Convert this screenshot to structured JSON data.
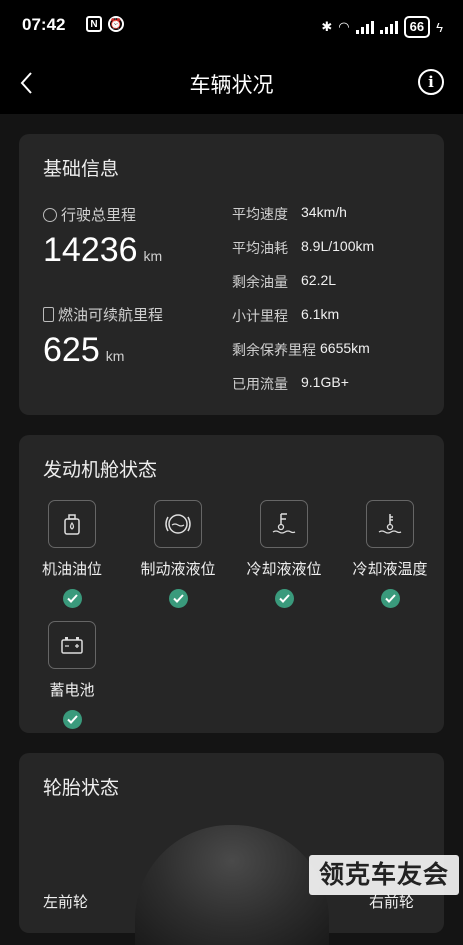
{
  "status_bar": {
    "time": "07:42",
    "battery": "66"
  },
  "header": {
    "title": "车辆状况"
  },
  "basic_info": {
    "title": "基础信息",
    "total_mileage_label": "行驶总里程",
    "total_mileage_value": "14236",
    "total_mileage_unit": "km",
    "range_label": "燃油可续航里程",
    "range_value": "625",
    "range_unit": "km",
    "stats": [
      {
        "label": "平均速度",
        "value": "34km/h"
      },
      {
        "label": "平均油耗",
        "value": "8.9L/100km"
      },
      {
        "label": "剩余油量",
        "value": "62.2L"
      },
      {
        "label": "小计里程",
        "value": "6.1km"
      },
      {
        "label": "剩余保养里程",
        "value": "6655km"
      },
      {
        "label": "已用流量",
        "value": "9.1GB+"
      }
    ]
  },
  "engine": {
    "title": "发动机舱状态",
    "items": [
      {
        "label": "机油油位",
        "icon": "oil-level-icon",
        "status": "ok"
      },
      {
        "label": "制动液液位",
        "icon": "brake-fluid-icon",
        "status": "ok"
      },
      {
        "label": "冷却液液位",
        "icon": "coolant-level-icon",
        "status": "ok"
      },
      {
        "label": "冷却液温度",
        "icon": "coolant-temp-icon",
        "status": "ok"
      },
      {
        "label": "蓄电池",
        "icon": "battery-icon",
        "status": "ok"
      }
    ]
  },
  "tire": {
    "title": "轮胎状态",
    "front_left_label": "左前轮",
    "front_right_label": "右前轮"
  },
  "watermark": "领克车友会",
  "colors": {
    "background": "#141414",
    "card": "#262626",
    "check": "#3a9a7c"
  }
}
